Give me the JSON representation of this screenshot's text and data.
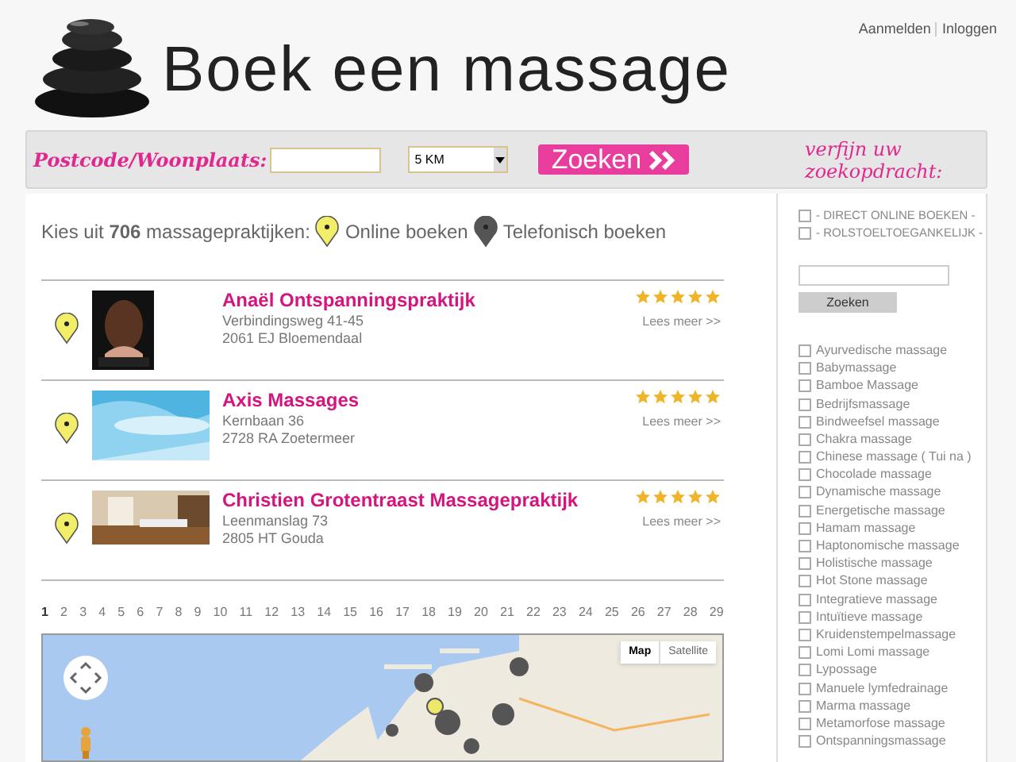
{
  "header": {
    "links": [
      "Aanmelden",
      "Inloggen"
    ],
    "title": "Boek een massage"
  },
  "search": {
    "label": "Postcode/Woonplaats:",
    "distance": "5 KM",
    "button": "Zoeken",
    "refine": "verfijn uw zoekopdracht:"
  },
  "intro": {
    "text": "Kies uit **706** massagepraktijken:",
    "legend": [
      {
        "kind": "online",
        "label": "Online boeken"
      },
      {
        "kind": "phone",
        "label": "Telefonisch boeken"
      }
    ]
  },
  "listings": [
    {
      "kind": "online",
      "name": "Anaël Ontspanningspraktijk",
      "street": "Verbindingsweg 41-45",
      "city": "2061 EJ Bloemendaal",
      "stars": 5,
      "more": "Lees meer >>"
    },
    {
      "kind": "online",
      "name": "Axis Massages",
      "street": "Kernbaan 36",
      "city": "2728 RA Zoetermeer",
      "stars": 5,
      "more": "Lees meer >>"
    },
    {
      "kind": "online",
      "name": "Christien Grotentraast Massagepraktijk",
      "street": "Leenmanslag 73",
      "city": "2805 HT Gouda",
      "stars": 5,
      "more": "Lees meer >>"
    }
  ],
  "pagination": [
    {
      "label": "1",
      "selected": true
    },
    {
      "label": "2",
      "selected": false
    },
    {
      "label": "3",
      "selected": false
    },
    {
      "label": "4",
      "selected": false
    },
    {
      "label": "5",
      "selected": false
    },
    {
      "label": "6",
      "selected": false
    },
    {
      "label": "7",
      "selected": false
    },
    {
      "label": "8",
      "selected": false
    },
    {
      "label": "9",
      "selected": false
    },
    {
      "label": "10",
      "selected": false
    },
    {
      "label": "11",
      "selected": false
    },
    {
      "label": "12",
      "selected": false
    },
    {
      "label": "13",
      "selected": false
    },
    {
      "label": "14",
      "selected": false
    },
    {
      "label": "15",
      "selected": false
    },
    {
      "label": "16",
      "selected": false
    },
    {
      "label": "17",
      "selected": false
    },
    {
      "label": "18",
      "selected": false
    },
    {
      "label": "19",
      "selected": false
    },
    {
      "label": "20",
      "selected": false
    },
    {
      "label": "21",
      "selected": false
    },
    {
      "label": "22",
      "selected": false
    },
    {
      "label": "23",
      "selected": false
    },
    {
      "label": "24",
      "selected": false
    },
    {
      "label": "25",
      "selected": false
    },
    {
      "label": "26",
      "selected": false
    },
    {
      "label": "27",
      "selected": false
    },
    {
      "label": "28",
      "selected": false
    },
    {
      "label": "29",
      "selected": false
    }
  ],
  "map": {
    "types": [
      {
        "label": "Map",
        "selected": true
      },
      {
        "label": "Satellite",
        "selected": false
      }
    ]
  },
  "filters": {
    "options": [
      {
        "label": "- DIRECT ONLINE BOEKEN -",
        "checked": false
      },
      {
        "label": "- ROLSTOELTOEGANKELIJK -",
        "checked": false
      }
    ],
    "button": "Zoeken",
    "types": [
      {
        "label": "Ayurvedische massage",
        "checked": false
      },
      {
        "label": "Babymassage",
        "checked": false
      },
      {
        "label": "Bamboe Massage",
        "checked": false
      },
      {
        "label": "Bedrijfsmassage",
        "checked": false
      },
      {
        "label": "Bindweefsel massage",
        "checked": false
      },
      {
        "label": "Chakra massage",
        "checked": false
      },
      {
        "label": "Chinese massage ( Tui na )",
        "checked": false
      },
      {
        "label": "Chocolade massage",
        "checked": false
      },
      {
        "label": "Dynamische massage",
        "checked": false
      },
      {
        "label": "Energetische massage",
        "checked": false
      },
      {
        "label": "Hamam massage",
        "checked": false
      },
      {
        "label": "Haptonomische massage",
        "checked": false
      },
      {
        "label": "Holistische massage",
        "checked": false
      },
      {
        "label": "Hot Stone massage",
        "checked": false
      },
      {
        "label": "Integratieve massage",
        "checked": false
      },
      {
        "label": "Intuïtieve massage",
        "checked": false
      },
      {
        "label": "Kruidenstempelmassage",
        "checked": false
      },
      {
        "label": "Lomi Lomi massage",
        "checked": false
      },
      {
        "label": "Lypossage",
        "checked": false
      },
      {
        "label": "Manuele lymfedrainage",
        "checked": false
      },
      {
        "label": "Marma massage",
        "checked": false
      },
      {
        "label": "Metamorfose massage",
        "checked": false
      },
      {
        "label": "Ontspanningsmassage",
        "checked": false
      }
    ]
  }
}
